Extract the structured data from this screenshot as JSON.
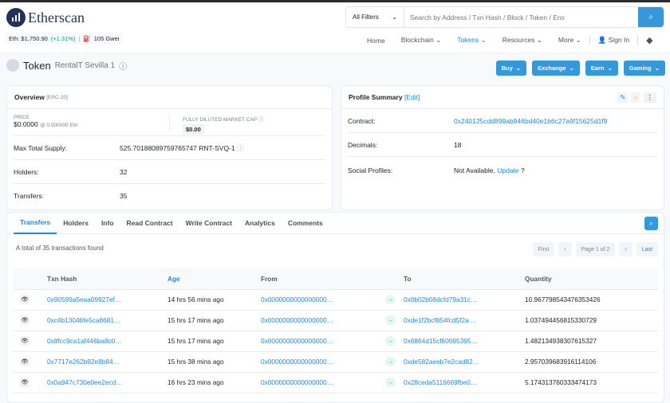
{
  "header": {
    "logo": "Etherscan",
    "eth_price": "Eth: $1,750.90",
    "eth_change": "(+1.31%)",
    "gas": "105 Gwei",
    "filter": "All Filters",
    "search_placeholder": "Search by Address / Txn Hash / Block / Token / Ens",
    "nav": [
      "Home",
      "Blockchain",
      "Tokens",
      "Resources",
      "More"
    ],
    "sign_in": "Sign In"
  },
  "token": {
    "label": "Token",
    "name": "RentalT Sevilla 1"
  },
  "actions": [
    "Buy",
    "Exchange",
    "Earn",
    "Gaming"
  ],
  "overview": {
    "title": "Overview",
    "type": "[ERC-20]",
    "price_label": "PRICE",
    "price": "$0.0000",
    "price_eth": "@ 0.000000 Eth",
    "mcap_label": "FULLY DILUTED MARKET CAP",
    "mcap": "$0.00",
    "supply_label": "Max Total Supply:",
    "supply": "525.70188089759765747 RNT-SVQ-1",
    "holders_label": "Holders:",
    "holders": "32",
    "transfers_label": "Transfers:",
    "transfers": "35"
  },
  "profile": {
    "title": "Profile Summary",
    "edit": "[Edit]",
    "contract_label": "Contract:",
    "contract": "0x240125cdd899ab946bd40e1b6c27a9f15625d1f9",
    "decimals_label": "Decimals:",
    "decimals": "18",
    "social_label": "Social Profiles:",
    "social": "Not Available,",
    "update": "Update",
    "q": "?"
  },
  "tabs": [
    "Transfers",
    "Holders",
    "Info",
    "Read Contract",
    "Write Contract",
    "Analytics",
    "Comments"
  ],
  "summary": "A total of 35 transactions found",
  "pagination": {
    "first": "First",
    "prev": "‹",
    "page": "Page 1 of 2",
    "next": "›",
    "last": "Last"
  },
  "table": {
    "headers": [
      "Txn Hash",
      "Age",
      "From",
      "To",
      "Quantity"
    ],
    "rows": [
      [
        "0x90599a5eaa09927ef…",
        "14 hrs 56 mins ago",
        "0x0000000000000000…",
        "0x0b02b08dcfd79a31c…",
        "10.967798543476353426"
      ],
      [
        "0xc4b13046fe5ca8681…",
        "15 hrs 17 mins ago",
        "0x0000000000000000…",
        "0xde1f2bcf854fcd5f2a…",
        "1.037494456815330729"
      ],
      [
        "0x8fcc9ca1af446ba8c0…",
        "15 hrs 17 mins ago",
        "0x0000000000000000…",
        "0x6864d15cf60095395…",
        "1.482134938307615327"
      ],
      [
        "0x7717e262b92e8b84…",
        "15 hrs 38 mins ago",
        "0x0000000000000000…",
        "0xde582aeeb7e2cad82…",
        "2.957039683916114106"
      ],
      [
        "0x0a947c730e0ee2ecd…",
        "16 hrs 23 mins ago",
        "0x0000000000000000…",
        "0x28ceda5116669fbe0…",
        "5.174313760333474173"
      ]
    ]
  }
}
